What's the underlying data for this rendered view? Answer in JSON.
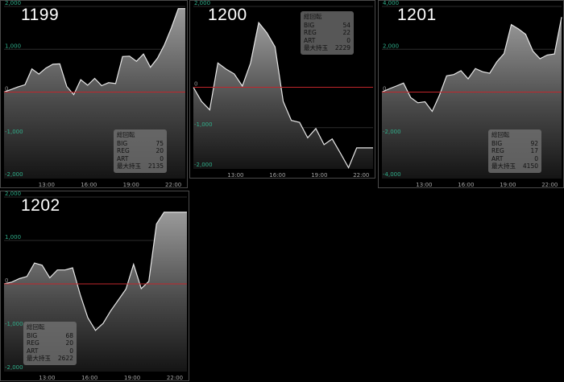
{
  "chart_data": [
    {
      "type": "area",
      "machine": "1199",
      "ylim": [
        -2000,
        2000
      ],
      "y_ticks": [
        "2,000",
        "1,000",
        "0",
        "-1,000",
        "-2,000"
      ],
      "x_ticks": [
        "13:00",
        "16:00",
        "19:00",
        "22:00"
      ],
      "values": [
        0,
        60,
        120,
        170,
        540,
        420,
        560,
        650,
        660,
        130,
        -60,
        290,
        160,
        320,
        150,
        220,
        200,
        830,
        840,
        720,
        890,
        580,
        790,
        1100,
        1500,
        1950,
        1950
      ],
      "stats": {
        "title": "総回転",
        "rows": [
          {
            "label": "BIG",
            "value": "75"
          },
          {
            "label": "REG",
            "value": "20"
          },
          {
            "label": "ART",
            "value": "0"
          },
          {
            "label": "最大持玉",
            "value": "2135"
          }
        ]
      }
    },
    {
      "type": "area",
      "machine": "1200",
      "ylim": [
        -2000,
        2000
      ],
      "y_ticks": [
        "2,000",
        "0",
        "-1,000",
        "-2,000"
      ],
      "x_ticks": [
        "13:00",
        "16:00",
        "19:00",
        "22:00"
      ],
      "values": [
        0,
        -350,
        -560,
        600,
        450,
        330,
        30,
        600,
        1600,
        1350,
        1000,
        -350,
        -820,
        -870,
        -1250,
        -1020,
        -1420,
        -1280,
        -1630,
        -1990,
        -1500,
        -1500,
        -1500
      ],
      "stats": {
        "title": "総回転",
        "rows": [
          {
            "label": "BIG",
            "value": "54"
          },
          {
            "label": "REG",
            "value": "22"
          },
          {
            "label": "ART",
            "value": "0"
          },
          {
            "label": "最大持玉",
            "value": "2229"
          }
        ]
      }
    },
    {
      "type": "area",
      "machine": "1201",
      "ylim": [
        -4000,
        4000
      ],
      "y_ticks": [
        "4,000",
        "2,000",
        "0",
        "-2,000",
        "-4,000"
      ],
      "x_ticks": [
        "13:00",
        "16:00",
        "19:00",
        "22:00"
      ],
      "values": [
        0,
        150,
        280,
        420,
        -250,
        -500,
        -450,
        -900,
        -150,
        760,
        820,
        1000,
        620,
        1100,
        950,
        880,
        1420,
        1800,
        3150,
        2950,
        2700,
        1920,
        1560,
        1730,
        1780,
        3500
      ],
      "stats": {
        "title": "総回転",
        "rows": [
          {
            "label": "BIG",
            "value": "92"
          },
          {
            "label": "REG",
            "value": "17"
          },
          {
            "label": "ART",
            "value": "0"
          },
          {
            "label": "最大持玉",
            "value": "4150"
          }
        ]
      }
    },
    {
      "type": "area",
      "machine": "1202",
      "ylim": [
        -2000,
        2000
      ],
      "y_ticks": [
        "2,000",
        "1,000",
        "0",
        "-1,000",
        "-2,000"
      ],
      "x_ticks": [
        "13:00",
        "16:00",
        "19:00",
        "22:00"
      ],
      "values": [
        0,
        40,
        120,
        170,
        480,
        430,
        140,
        320,
        320,
        370,
        -250,
        -780,
        -1070,
        -910,
        -620,
        -370,
        -120,
        450,
        -110,
        60,
        1380,
        1650,
        1650,
        1650,
        1650
      ],
      "stats": {
        "title": "総回転",
        "rows": [
          {
            "label": "BIG",
            "value": "68"
          },
          {
            "label": "REG",
            "value": "20"
          },
          {
            "label": "ART",
            "value": "0"
          },
          {
            "label": "最大持玉",
            "value": "2622"
          }
        ]
      }
    }
  ]
}
